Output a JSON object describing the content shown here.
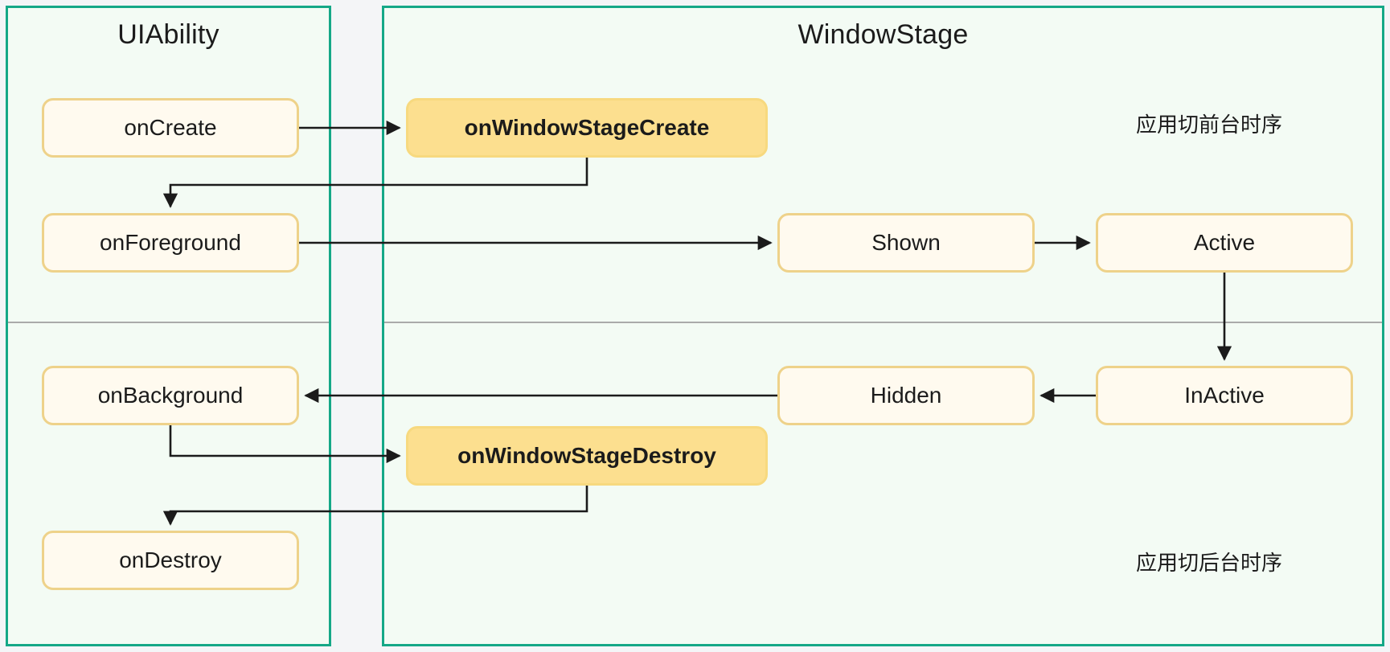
{
  "panels": [
    {
      "id": "uiability",
      "title": "UIAbility"
    },
    {
      "id": "windowstage",
      "title": "WindowStage"
    }
  ],
  "nodes": {
    "oncreate": "onCreate",
    "onforeground": "onForeground",
    "onbackground": "onBackground",
    "ondestroy": "onDestroy",
    "onwindowstagecreate": "onWindowStageCreate",
    "onwindowstagedestroy": "onWindowStageDestroy",
    "shown": "Shown",
    "active": "Active",
    "hidden": "Hidden",
    "inactive": "InActive"
  },
  "notes": {
    "foreground_sequence": "应用切前台时序",
    "background_sequence": "应用切后台时序"
  },
  "colors": {
    "panel_border": "#15a887",
    "panel_fill": "#f3fbf4",
    "node_fill": "#fffaef",
    "node_border": "#eed28a",
    "accent_fill": "#fcdf8f",
    "accent_border": "#f7d97f",
    "edge": "#1b1b1b",
    "divider": "#aaaaaa",
    "canvas": "#f4f5f7"
  },
  "edges": [
    {
      "from": "oncreate",
      "to": "onwindowstagecreate"
    },
    {
      "from": "onwindowstagecreate",
      "to": "onforeground"
    },
    {
      "from": "onforeground",
      "to": "shown"
    },
    {
      "from": "shown",
      "to": "active"
    },
    {
      "from": "active",
      "to": "inactive"
    },
    {
      "from": "inactive",
      "to": "hidden"
    },
    {
      "from": "hidden",
      "to": "onbackground"
    },
    {
      "from": "onbackground",
      "to": "onwindowstagedestroy"
    },
    {
      "from": "onwindowstagedestroy",
      "to": "ondestroy"
    }
  ]
}
